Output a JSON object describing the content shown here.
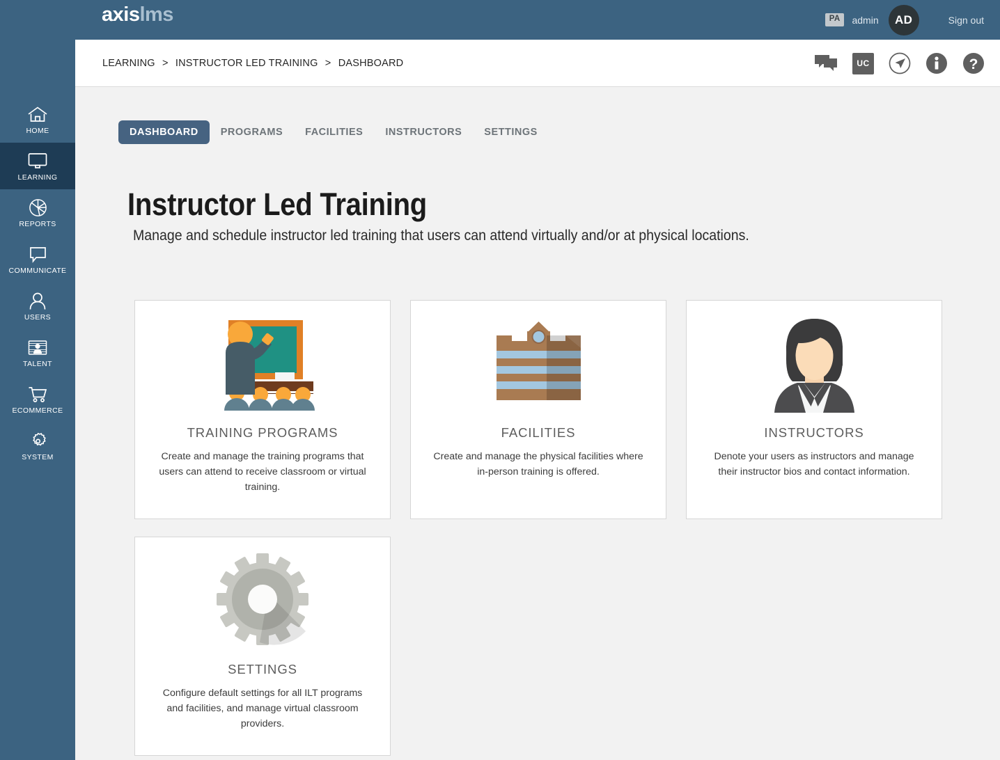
{
  "brand": {
    "logo_primary": "axis",
    "logo_secondary": "lms",
    "header_bg": "#3c6381",
    "sidebar_bg": "#3c6381",
    "sidebar_active_bg": "#1e3c55",
    "tab_active_bg": "#466381",
    "content_bg": "#f2f2f2"
  },
  "header": {
    "role_badge": "PA",
    "username": "admin",
    "avatar_initials": "AD",
    "sign_out": "Sign out"
  },
  "breadcrumb": {
    "items": [
      "LEARNING",
      "INSTRUCTOR LED TRAINING",
      "DASHBOARD"
    ],
    "separator": ">"
  },
  "breadcrumb_icons": [
    {
      "name": "chat-icon",
      "label": ""
    },
    {
      "name": "uc-icon",
      "label": "UC"
    },
    {
      "name": "navigation-icon",
      "label": ""
    },
    {
      "name": "info-icon",
      "label": "i"
    },
    {
      "name": "help-icon",
      "label": "?"
    }
  ],
  "sidebar": {
    "items": [
      {
        "label": "HOME",
        "icon": "home-icon",
        "active": false
      },
      {
        "label": "LEARNING",
        "icon": "monitor-icon",
        "active": true
      },
      {
        "label": "REPORTS",
        "icon": "pie-chart-icon",
        "active": false
      },
      {
        "label": "COMMUNICATE",
        "icon": "speech-bubble-icon",
        "active": false
      },
      {
        "label": "USERS",
        "icon": "person-icon",
        "active": false
      },
      {
        "label": "TALENT",
        "icon": "id-card-icon",
        "active": false
      },
      {
        "label": "ECOMMERCE",
        "icon": "shopping-cart-icon",
        "active": false
      },
      {
        "label": "SYSTEM",
        "icon": "gear-icon",
        "active": false
      }
    ]
  },
  "tabs": [
    {
      "label": "DASHBOARD",
      "active": true
    },
    {
      "label": "PROGRAMS",
      "active": false
    },
    {
      "label": "FACILITIES",
      "active": false
    },
    {
      "label": "INSTRUCTORS",
      "active": false
    },
    {
      "label": "SETTINGS",
      "active": false
    }
  ],
  "page": {
    "title": "Instructor Led Training",
    "subtitle": "Manage and schedule instructor led training that users can attend virtually and/or at physical locations."
  },
  "cards": [
    {
      "title": "TRAINING PROGRAMS",
      "description": "Create and manage the training programs that users can attend to receive classroom or virtual training.",
      "icon": "classroom-teacher-illustration"
    },
    {
      "title": "FACILITIES",
      "description": "Create and manage the physical facilities where in-person training is offered.",
      "icon": "school-building-illustration"
    },
    {
      "title": "INSTRUCTORS",
      "description": "Denote your users as instructors and manage their instructor bios and contact information.",
      "icon": "instructor-avatar-illustration"
    },
    {
      "title": "SETTINGS",
      "description": "Configure default settings for all ILT programs and facilities, and manage virtual classroom providers.",
      "icon": "gear-illustration"
    }
  ]
}
